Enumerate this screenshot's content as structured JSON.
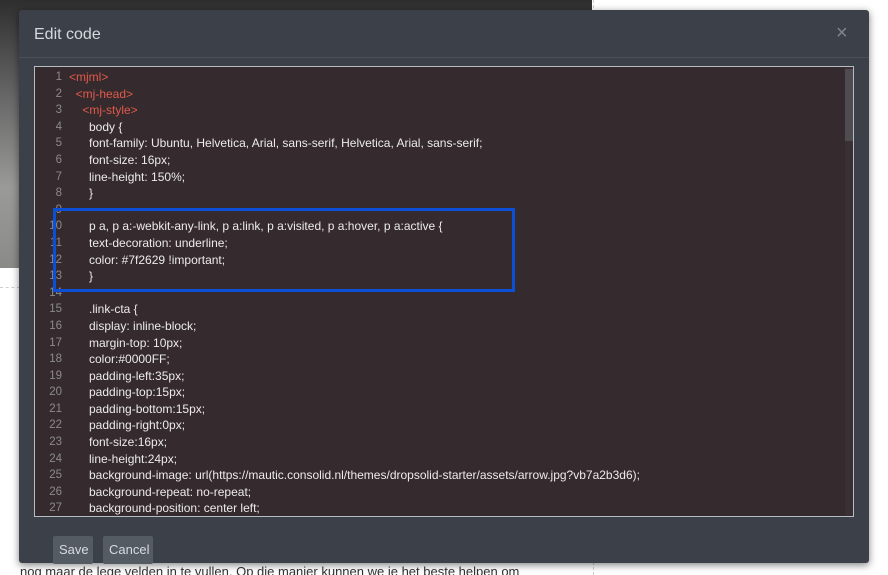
{
  "background": {
    "text": "nog maar de lege velden in te vullen. Op die manier kunnen we je het beste helpen om"
  },
  "modal": {
    "title": "Edit code",
    "close_label": "×",
    "save_label": "Save",
    "cancel_label": "Cancel"
  },
  "editor": {
    "lines": [
      {
        "num": "1",
        "text": "<mjml>",
        "kind": "tag"
      },
      {
        "num": "2",
        "text": "  <mj-head>",
        "kind": "tag"
      },
      {
        "num": "3",
        "text": "    <mj-style>",
        "kind": "tag"
      },
      {
        "num": "4",
        "text": "      body {",
        "kind": "text"
      },
      {
        "num": "5",
        "text": "      font-family: Ubuntu, Helvetica, Arial, sans-serif, Helvetica, Arial, sans-serif;",
        "kind": "text"
      },
      {
        "num": "6",
        "text": "      font-size: 16px;",
        "kind": "text"
      },
      {
        "num": "7",
        "text": "      line-height: 150%;",
        "kind": "text"
      },
      {
        "num": "8",
        "text": "      }",
        "kind": "text"
      },
      {
        "num": "9",
        "text": "",
        "kind": "text"
      },
      {
        "num": "10",
        "text": "      p a, p a:-webkit-any-link, p a:link, p a:visited, p a:hover, p a:active {",
        "kind": "text"
      },
      {
        "num": "11",
        "text": "      text-decoration: underline;",
        "kind": "text"
      },
      {
        "num": "12",
        "text": "      color: #7f2629 !important;",
        "kind": "text"
      },
      {
        "num": "13",
        "text": "      }",
        "kind": "text"
      },
      {
        "num": "14",
        "text": "",
        "kind": "text"
      },
      {
        "num": "15",
        "text": "      .link-cta {",
        "kind": "text"
      },
      {
        "num": "16",
        "text": "      display: inline-block;",
        "kind": "text"
      },
      {
        "num": "17",
        "text": "      margin-top: 10px;",
        "kind": "text"
      },
      {
        "num": "18",
        "text": "      color:#0000FF;",
        "kind": "text"
      },
      {
        "num": "19",
        "text": "      padding-left:35px;",
        "kind": "text"
      },
      {
        "num": "20",
        "text": "      padding-top:15px;",
        "kind": "text"
      },
      {
        "num": "21",
        "text": "      padding-bottom:15px;",
        "kind": "text"
      },
      {
        "num": "22",
        "text": "      padding-right:0px;",
        "kind": "text"
      },
      {
        "num": "23",
        "text": "      font-size:16px;",
        "kind": "text"
      },
      {
        "num": "24",
        "text": "      line-height:24px;",
        "kind": "text"
      },
      {
        "num": "25",
        "text": "      background-image: url(https://mautic.consolid.nl/themes/dropsolid-starter/assets/arrow.jpg?vb7a2b3d6);",
        "kind": "text"
      },
      {
        "num": "26",
        "text": "      background-repeat: no-repeat;",
        "kind": "text"
      },
      {
        "num": "27",
        "text": "      background-position: center left;",
        "kind": "text"
      }
    ]
  }
}
